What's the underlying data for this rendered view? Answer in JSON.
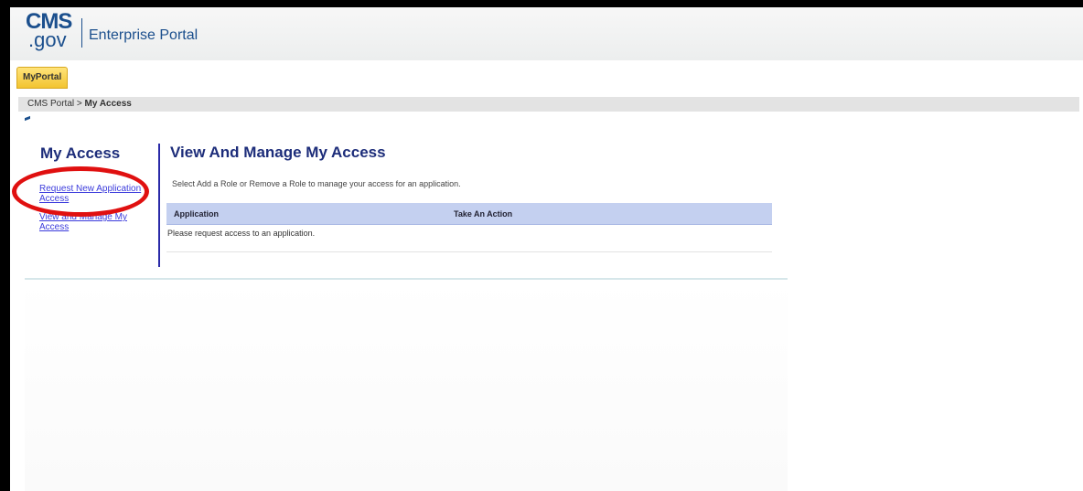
{
  "header": {
    "logo_primary": "CMS",
    "logo_secondary": ".gov",
    "title": "Enterprise Portal"
  },
  "nav": {
    "tab_myportal": "MyPortal"
  },
  "breadcrumb": {
    "root": "CMS Portal",
    "separator": " > ",
    "current": "My Access"
  },
  "sidebar": {
    "title": "My Access",
    "links": [
      {
        "label": "Request New Application Access"
      },
      {
        "label": "View and Manage My Access"
      }
    ]
  },
  "main": {
    "title": "View And Manage My Access",
    "instructions": "Select Add a Role or Remove a Role to manage your access for an application.",
    "table": {
      "columns": [
        "Application",
        "Take An Action"
      ],
      "empty_message": "Please request access to an application."
    }
  },
  "colors": {
    "brand": "#1b4f8d",
    "heading": "#1d2d7a",
    "link": "#3b3bdc",
    "table_header": "#c4d0f0",
    "tab_highlight": "#f2c430",
    "annotation": "#e01010"
  }
}
